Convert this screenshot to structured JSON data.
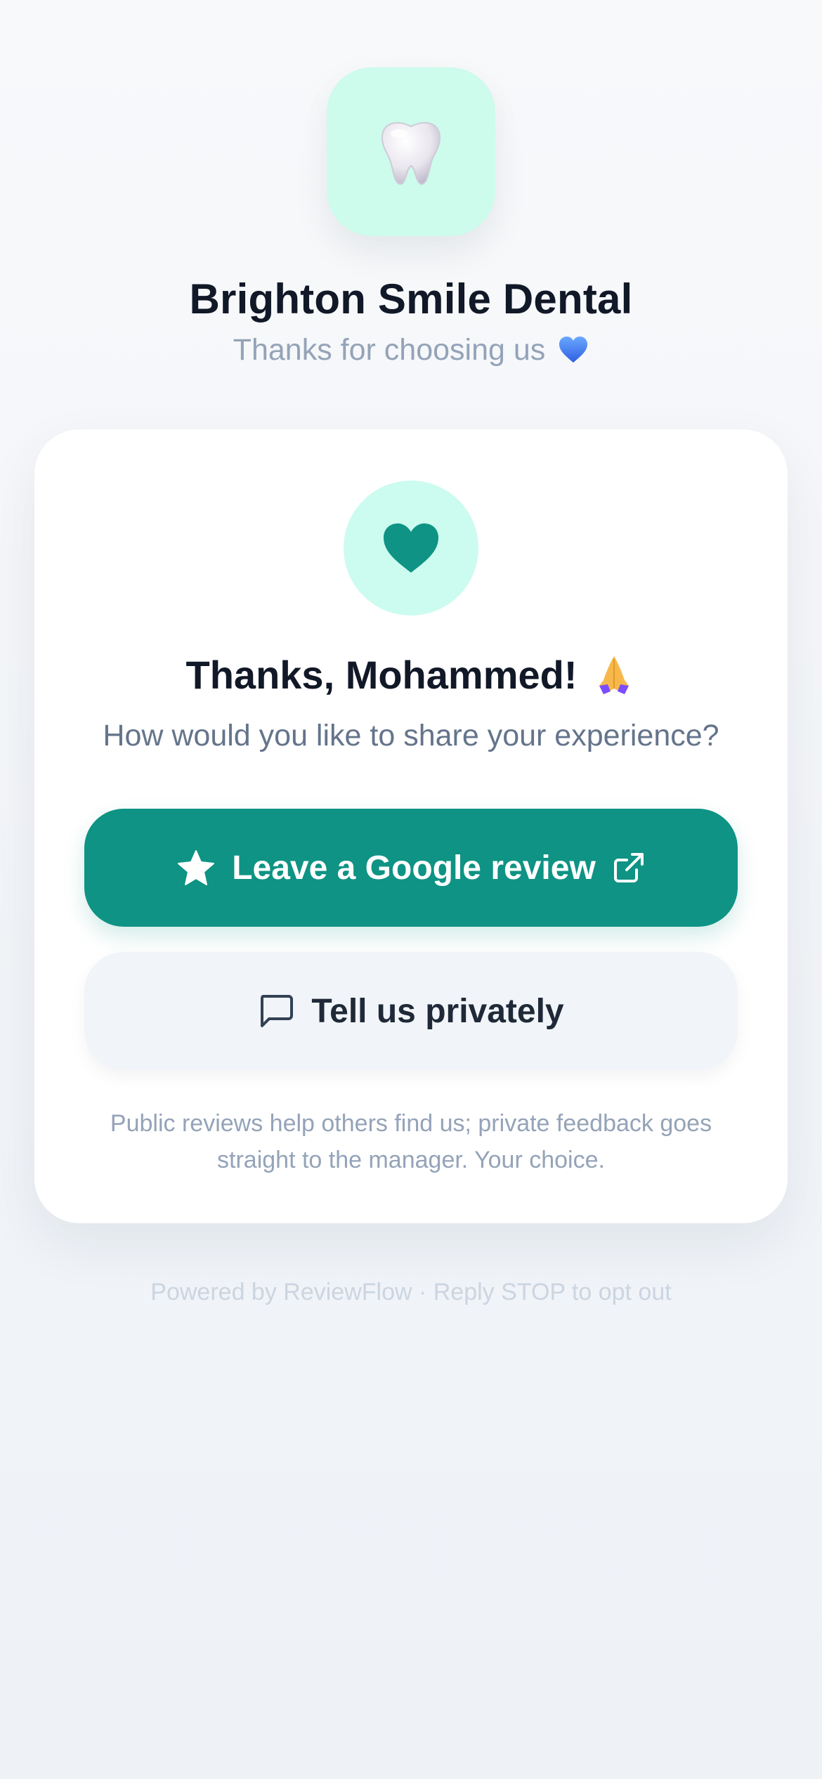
{
  "header": {
    "logo_icon": "tooth-icon",
    "clinic_name": "Brighton Smile Dental",
    "subtitle": "Thanks for choosing us",
    "subtitle_icon": "blue-heart-icon"
  },
  "card": {
    "top_icon": "heart-icon",
    "greeting": "Thanks, Mohammed!",
    "greeting_icon": "folded-hands-icon",
    "prompt": "How would you like to share your experience?",
    "google_button": {
      "label": "Leave a Google review",
      "leading_icon": "star-icon",
      "trailing_icon": "external-link-icon"
    },
    "private_button": {
      "label": "Tell us privately",
      "leading_icon": "chat-bubble-icon"
    },
    "footnote": "Public reviews help others find us; private feedback goes straight to the manager. Your choice."
  },
  "footer": {
    "powered_by": "Powered by ReviewFlow · Reply STOP to opt out"
  },
  "colors": {
    "accent": "#0e9384",
    "accent_light": "#ccfbef",
    "title": "#111827",
    "muted": "#94a3b8"
  }
}
